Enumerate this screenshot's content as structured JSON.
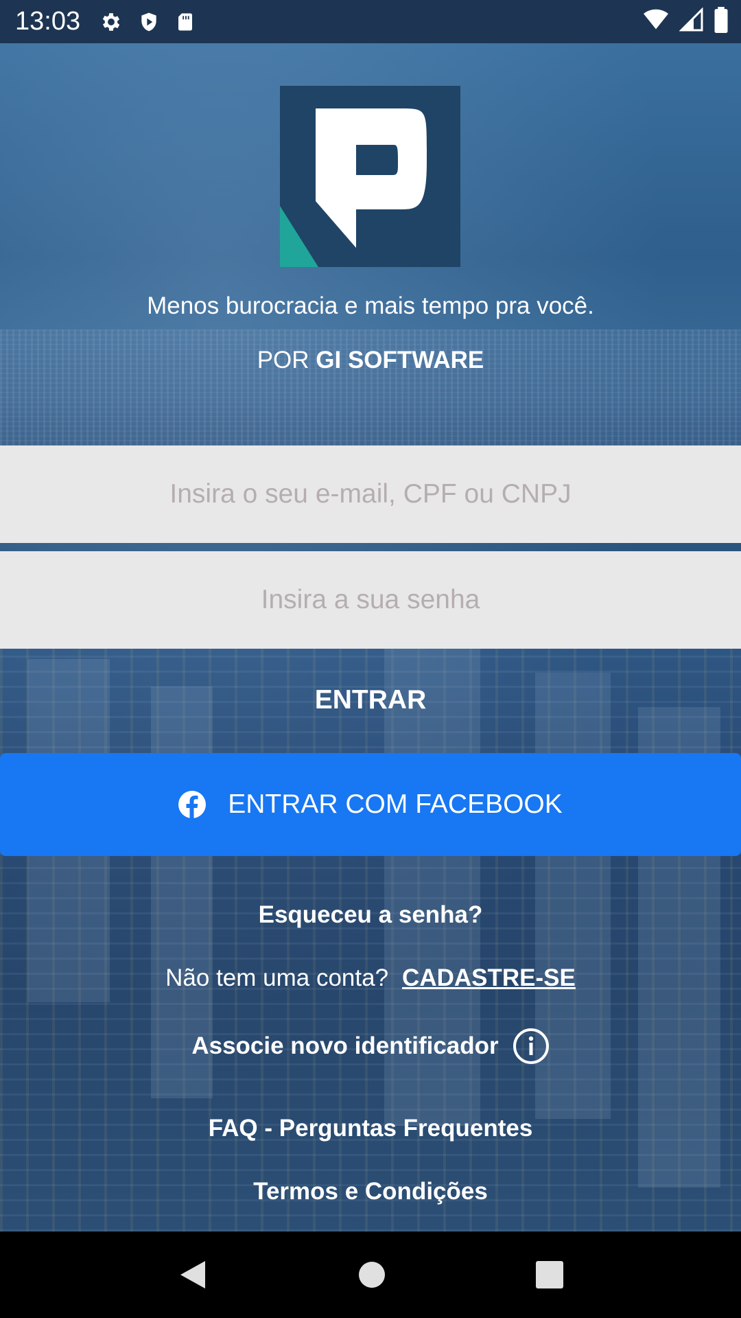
{
  "status_bar": {
    "time": "13:03",
    "left_icons": [
      "settings-icon",
      "shield-icon",
      "sd-card-icon"
    ],
    "right_icons": [
      "wifi-icon",
      "signal-icon",
      "battery-icon"
    ]
  },
  "header": {
    "logo_icon": "app-logo-p",
    "tagline": "Menos burocracia e mais tempo pra você.",
    "byline_prefix": "POR ",
    "byline_brand": "GI SOFTWARE"
  },
  "form": {
    "email_placeholder": "Insira o seu e-mail, CPF ou CNPJ",
    "email_value": "",
    "password_placeholder": "Insira a sua senha",
    "password_value": "",
    "login_label": "ENTRAR",
    "facebook_label": "ENTRAR COM FACEBOOK"
  },
  "links": {
    "forgot_password": "Esqueceu a senha?",
    "no_account": "Não tem uma conta?",
    "signup": "CADASTRE-SE",
    "associate": "Associe novo identificador",
    "faq": "FAQ - Perguntas Frequentes",
    "terms": "Termos e Condições"
  },
  "colors": {
    "facebook_blue": "#1877f2",
    "logo_navy": "#1f4466",
    "logo_teal": "#1fa59a",
    "input_bg": "#e9e8e9"
  },
  "nav_bar": {
    "buttons": [
      "back-icon",
      "home-icon",
      "recents-icon"
    ]
  }
}
